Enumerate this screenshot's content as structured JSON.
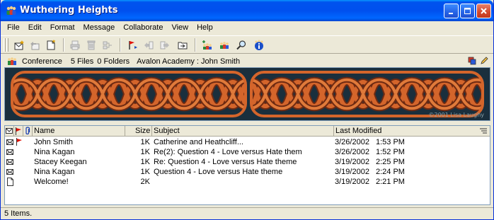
{
  "window": {
    "title": "Wuthering Heights",
    "controls": [
      "minimize",
      "maximize",
      "close"
    ]
  },
  "menu": {
    "items": [
      "File",
      "Edit",
      "Format",
      "Message",
      "Collaborate",
      "View",
      "Help"
    ]
  },
  "toolbar": {
    "icons": [
      "new-message-icon",
      "reply-icon",
      "new-document-icon",
      "print-icon",
      "delete-icon",
      "properties-icon",
      "flag-icon",
      "reply-all-icon",
      "forward-icon",
      "folder-icon",
      "add-member-icon",
      "members-icon",
      "find-icon",
      "info-icon"
    ]
  },
  "infobar": {
    "conference": "Conference",
    "files": "5 Files",
    "folders": "0 Folders",
    "location": "Avalon Academy : John Smith"
  },
  "banner": {
    "credit": "©2001 Lisa Laughy"
  },
  "list": {
    "columns": {
      "name": "Name",
      "size": "Size",
      "subject": "Subject",
      "modified": "Last Modified"
    },
    "rows": [
      {
        "type": "message",
        "flag": true,
        "name": "John Smith",
        "size": "1K",
        "subject": "Catherine and Heathcliff...",
        "date": "3/26/2002",
        "time": "1:53 PM"
      },
      {
        "type": "message",
        "flag": false,
        "name": "Nina Kagan",
        "size": "1K",
        "subject": "Re(2): Question 4 - Love versus Hate them",
        "date": "3/26/2002",
        "time": "1:52 PM"
      },
      {
        "type": "message",
        "flag": false,
        "name": "Stacey Keegan",
        "size": "1K",
        "subject": "Re: Question 4 - Love versus Hate theme",
        "date": "3/19/2002",
        "time": "2:25 PM"
      },
      {
        "type": "message",
        "flag": false,
        "name": "Nina Kagan",
        "size": "1K",
        "subject": "Question 4 - Love versus Hate theme",
        "date": "3/19/2002",
        "time": "2:24 PM"
      },
      {
        "type": "document",
        "flag": false,
        "name": "Welcome!",
        "size": "2K",
        "subject": "",
        "date": "3/19/2002",
        "time": "2:21 PM"
      }
    ]
  },
  "status": {
    "text": "5 Items."
  },
  "colors": {
    "titlebar": "#0053ee",
    "banner_knot": "#d4652b",
    "banner_background": "#1a2f3d",
    "flag": "#e0140a"
  }
}
